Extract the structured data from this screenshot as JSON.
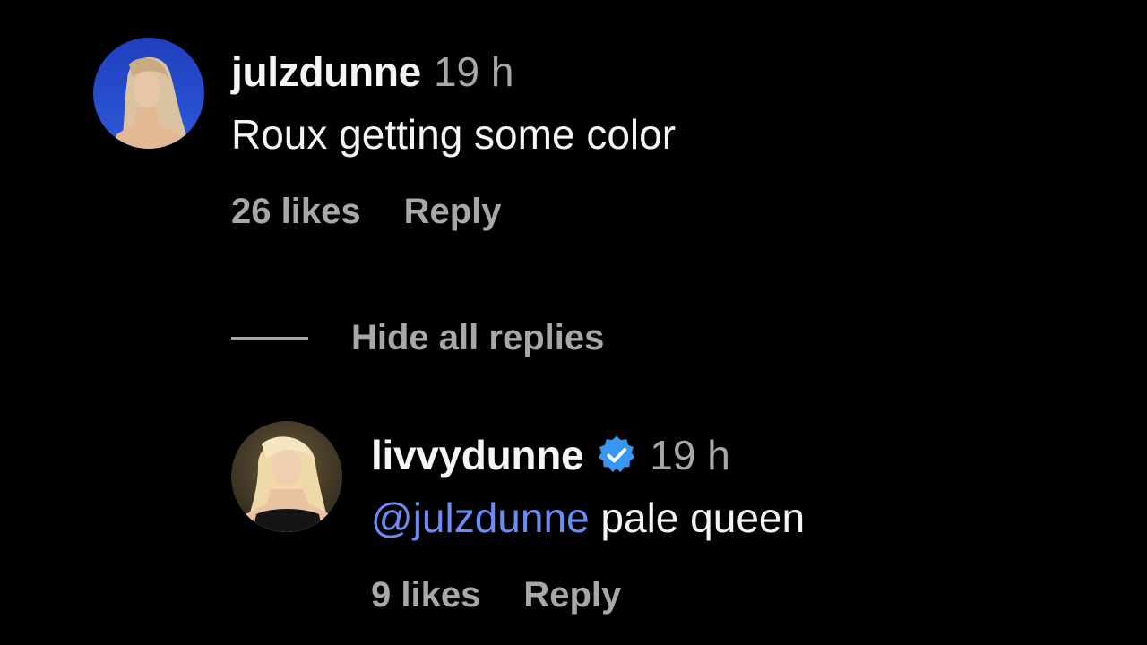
{
  "comment": {
    "username": "julzdunne",
    "time": "19 h",
    "text": "Roux getting some color",
    "likes": "26 likes",
    "reply_label": "Reply",
    "avatar_icon": "avatar-photo-julzdunne"
  },
  "replies_toggle": {
    "label": "Hide all replies"
  },
  "reply": {
    "username": "livvydunne",
    "verified_icon": "verified-badge-icon",
    "time": "19 h",
    "mention": "@julzdunne",
    "text": " pale queen",
    "likes": "9 likes",
    "reply_label": "Reply",
    "avatar_icon": "avatar-photo-livvydunne"
  },
  "colors": {
    "background": "#000000",
    "primary_text": "#f5f5f5",
    "secondary_text": "#a8a8a8",
    "mention": "#6c8cf5",
    "verified": "#3897f0"
  }
}
